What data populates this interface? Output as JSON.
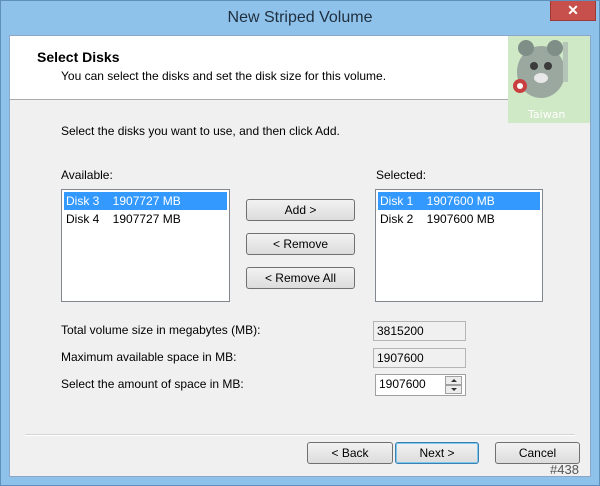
{
  "window": {
    "title": "New Striped Volume",
    "close_glyph": "✕"
  },
  "header": {
    "title": "Select Disks",
    "subtitle": "You can select the disks and set the disk size for this volume.",
    "logo_text": "Taiwan"
  },
  "instructions": "Select the disks you want to use, and then click Add.",
  "available": {
    "label": "Available:",
    "items": [
      {
        "text": "Disk 3    1907727 MB",
        "selected": true
      },
      {
        "text": "Disk 4    1907727 MB",
        "selected": false
      }
    ]
  },
  "selected": {
    "label": "Selected:",
    "items": [
      {
        "text": "Disk 1    1907600 MB",
        "selected": true
      },
      {
        "text": "Disk 2    1907600 MB",
        "selected": false
      }
    ]
  },
  "buttons": {
    "add": "Add >",
    "remove": "< Remove",
    "remove_all": "< Remove All",
    "back": "< Back",
    "next": "Next >",
    "cancel": "Cancel"
  },
  "fields": {
    "total_label": "Total volume size in megabytes (MB):",
    "total_value": "3815200",
    "max_label": "Maximum available space in MB:",
    "max_value": "1907600",
    "amount_label": "Select the amount of space in MB:",
    "amount_value": "1907600"
  },
  "corner_tag": "#438",
  "colors": {
    "title_bar": "#8fc2ea",
    "selection": "#3399ff",
    "close_button": "#c7504c"
  }
}
